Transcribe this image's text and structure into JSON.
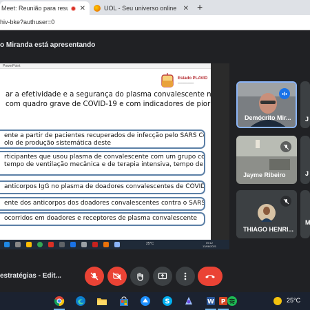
{
  "browser": {
    "tabs": [
      {
        "title": "Meet: Reunião para resultad",
        "active": true,
        "recording": true
      },
      {
        "title": "UOL - Seu universo online",
        "active": false
      }
    ],
    "close_glyph": "✕",
    "new_tab_glyph": "+",
    "url": "hiv-bke?authuser=0"
  },
  "meet": {
    "presenting_banner": "o Miranda está apresentando",
    "meeting_title": "estratégias - Edit...",
    "controls": [
      {
        "name": "mic-off-icon",
        "state": "off"
      },
      {
        "name": "camera-off-icon",
        "state": "off"
      },
      {
        "name": "raise-hand-icon",
        "state": "neutral"
      },
      {
        "name": "present-screen-icon",
        "state": "neutral"
      },
      {
        "name": "more-options-icon",
        "state": "neutral"
      },
      {
        "name": "hangup-icon",
        "state": "end"
      }
    ]
  },
  "slide": {
    "app_title": "PowerPoint",
    "logo_title": "Estado PLAVID",
    "intro_lines": [
      "ar a efetividade e a segurança do plasma convalescente no",
      "com quadro grave de COVID-19 e com indicadores de pior"
    ],
    "boxes": [
      {
        "lines": [
          "ente a partir de pacientes recuperados de infecção pelo SARS Cov-2",
          "olo de produção sistemática deste"
        ]
      },
      {
        "lines": [
          "rticipantes que usou plasma  de convalescente com um grupo controle",
          "tempo de ventilação mecânica e de terapia intensiva, tempo de"
        ]
      },
      {
        "lines": [
          "anticorpos IgG no plasma de doadores convalescentes de COVID-19"
        ]
      },
      {
        "lines": [
          "ente dos anticorpos dos doadores convalescentes contra o SARS COV-2"
        ]
      },
      {
        "lines": [
          "ocorridos em doadores e receptores de plasma convalescente"
        ]
      }
    ],
    "inner_taskbar": {
      "weather": "25°C",
      "time": "09:12",
      "date": "13/06/2021"
    }
  },
  "participants": [
    {
      "name": "Demócrito Mir...",
      "mic": "active",
      "highlighted": true
    },
    {
      "name": "Jayme Ribeiro",
      "mic": "muted"
    },
    {
      "name": "THIAGO HENRI...",
      "mic": "muted"
    }
  ],
  "cut_tiles": [
    "J",
    "J",
    "M"
  ],
  "system_taskbar": {
    "weather": "25°C",
    "apps": [
      "chrome-icon",
      "edge-icon",
      "file-explorer-icon",
      "store-icon",
      "app-icon",
      "skype-icon",
      "photos-icon",
      "word-icon",
      "powerpoint-icon",
      "spotify-icon"
    ]
  },
  "colors": {
    "meet_background": "#202124",
    "accent_blue": "#1a73e8",
    "danger_red": "#ea4335",
    "slide_box_border": "#5b7fa6"
  }
}
